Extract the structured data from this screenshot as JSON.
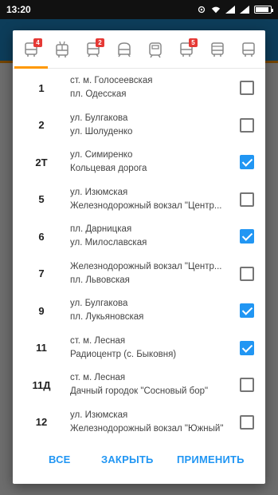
{
  "status": {
    "time": "13:20"
  },
  "transport_tabs": [
    {
      "icon": "bus-icon",
      "badge": "4",
      "active": true
    },
    {
      "icon": "trolleybus-icon",
      "badge": "",
      "active": false
    },
    {
      "icon": "tram-icon",
      "badge": "2",
      "active": false
    },
    {
      "icon": "metro-icon",
      "badge": "",
      "active": false
    },
    {
      "icon": "suburban-train-icon",
      "badge": "",
      "active": false
    },
    {
      "icon": "funicular-icon",
      "badge": "5",
      "active": false
    },
    {
      "icon": "minibus-icon",
      "badge": "",
      "active": false
    },
    {
      "icon": "intercity-bus-icon",
      "badge": "",
      "active": false
    }
  ],
  "routes": [
    {
      "number": "1",
      "from": "ст. м. Голосеевская",
      "to": "пл. Одесская",
      "checked": false
    },
    {
      "number": "2",
      "from": "ул. Булгакова",
      "to": "ул. Шолуденко",
      "checked": false
    },
    {
      "number": "2Т",
      "from": "ул. Симиренко",
      "to": "Кольцевая дорога",
      "checked": true
    },
    {
      "number": "5",
      "from": "ул. Изюмская",
      "to": "Железнодорожный вокзал \"Центр...",
      "checked": false
    },
    {
      "number": "6",
      "from": "пл. Дарницкая",
      "to": "ул. Милославская",
      "checked": true
    },
    {
      "number": "7",
      "from": "Железнодорожный вокзал \"Центр...",
      "to": "пл. Львовская",
      "checked": false
    },
    {
      "number": "9",
      "from": "ул. Булгакова",
      "to": "пл. Лукьяновская",
      "checked": true
    },
    {
      "number": "11",
      "from": "ст. м. Лесная",
      "to": "Радиоцентр (с. Быковня)",
      "checked": true
    },
    {
      "number": "11Д",
      "from": "ст. м. Лесная",
      "to": "Дачный городок \"Сосновый бор\"",
      "checked": false
    },
    {
      "number": "12",
      "from": "ул. Изюмская",
      "to": "Железнодорожный вокзал \"Южный\"",
      "checked": false
    }
  ],
  "actions": {
    "all": "ВСЕ",
    "close": "ЗАКРЫТЬ",
    "apply": "ПРИМЕНИТЬ"
  },
  "colors": {
    "accent": "#2196f3",
    "tab_indicator": "#ff9800",
    "badge": "#e53935"
  }
}
